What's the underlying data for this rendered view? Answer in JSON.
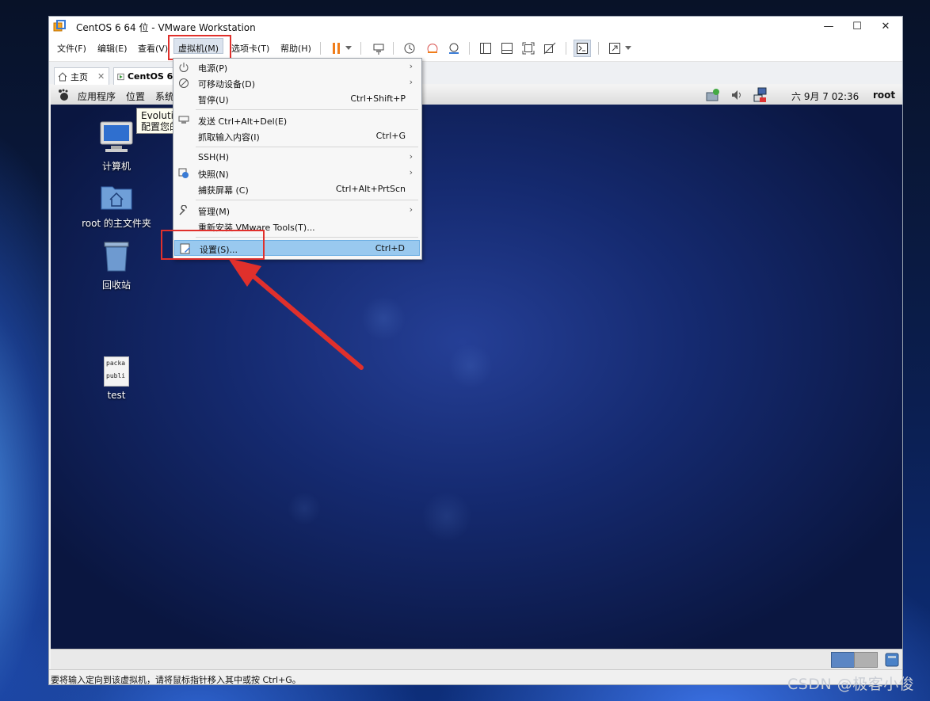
{
  "window": {
    "title": "CentOS 6 64 位 - VMware Workstation"
  },
  "menubar": {
    "file": "文件(F)",
    "edit": "编辑(E)",
    "view": "查看(V)",
    "vm": "虚拟机(M)",
    "tabs": "选项卡(T)",
    "help": "帮助(H)"
  },
  "tabs": {
    "home": "主页",
    "vm": "CentOS 6 64"
  },
  "gnome_panel": {
    "apps": "应用程序",
    "places": "位置",
    "system": "系统",
    "clock": "六 9月  7 02:36",
    "user": "root"
  },
  "tooltip": {
    "line1": "Evolution",
    "line2": "配置您的"
  },
  "desktop_icons": {
    "computer": "计算机",
    "home": "root 的主文件夹",
    "trash": "回收站",
    "test": "test",
    "test_preview1": "packa",
    "test_preview2": "publi"
  },
  "dropdown": {
    "power": "电源(P)",
    "removable": "可移动设备(D)",
    "pause": "暂停(U)",
    "pause_sc": "Ctrl+Shift+P",
    "send_cad": "发送 Ctrl+Alt+Del(E)",
    "grab": "抓取输入内容(I)",
    "grab_sc": "Ctrl+G",
    "ssh": "SSH(H)",
    "snapshot": "快照(N)",
    "capture": "捕获屏幕 (C)",
    "capture_sc": "Ctrl+Alt+PrtScn",
    "manage": "管理(M)",
    "reinstall": "重新安装 VMware Tools(T)...",
    "settings": "设置(S)...",
    "settings_sc": "Ctrl+D"
  },
  "statusbar": {
    "text": "要将输入定向到该虚拟机，请将鼠标指针移入其中或按 Ctrl+G。"
  },
  "watermark": "CSDN @极客小俊",
  "colors": {
    "highlight": "#99c9ef",
    "annotation_red": "#e0302c",
    "pause_orange": "#f07d1a"
  }
}
